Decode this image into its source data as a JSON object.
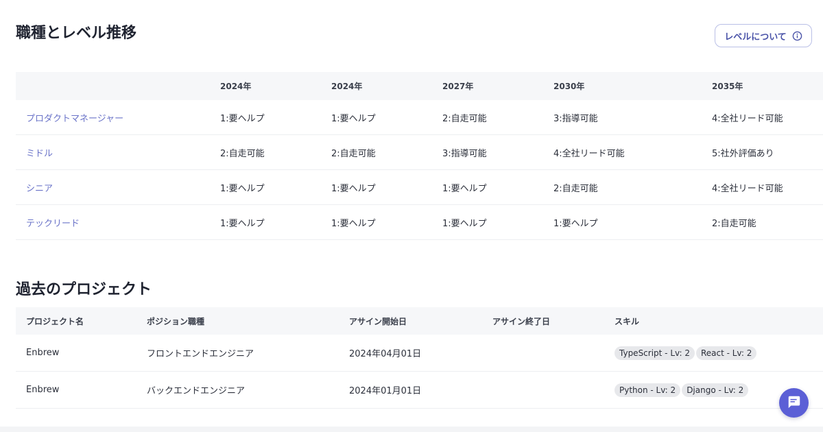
{
  "levels": {
    "title": "職種とレベル推移",
    "about_button": "レベルについて",
    "columns": [
      "",
      "2024年",
      "2024年",
      "2027年",
      "2030年",
      "2035年"
    ],
    "rows": [
      {
        "role": "プロダクトマネージャー",
        "values": [
          "1:要ヘルプ",
          "1:要ヘルプ",
          "2:自走可能",
          "3:指導可能",
          "4:全社リード可能"
        ]
      },
      {
        "role": "ミドル",
        "values": [
          "2:自走可能",
          "2:自走可能",
          "3:指導可能",
          "4:全社リード可能",
          "5:社外評価あり"
        ]
      },
      {
        "role": "シニア",
        "values": [
          "1:要ヘルプ",
          "1:要ヘルプ",
          "1:要ヘルプ",
          "2:自走可能",
          "4:全社リード可能"
        ]
      },
      {
        "role": "テックリード",
        "values": [
          "1:要ヘルプ",
          "1:要ヘルプ",
          "1:要ヘルプ",
          "1:要ヘルプ",
          "2:自走可能"
        ]
      }
    ]
  },
  "projects": {
    "title": "過去のプロジェクト",
    "columns": [
      "プロジェクト名",
      "ポジション職種",
      "アサイン開始日",
      "アサイン終了日",
      "スキル"
    ],
    "rows": [
      {
        "name": "Enbrew",
        "position": "フロントエンドエンジニア",
        "start": "2024年04月01日",
        "end": "",
        "skills": [
          "TypeScript - Lv: 2",
          "React - Lv: 2"
        ]
      },
      {
        "name": "Enbrew",
        "position": "バックエンドエンジニア",
        "start": "2024年01月01日",
        "end": "",
        "skills": [
          "Python - Lv: 2",
          "Django - Lv: 2"
        ]
      }
    ]
  },
  "icons": {
    "about": "info-icon",
    "chat": "chat-icon"
  },
  "colors": {
    "accent": "#5b5fd6",
    "link": "#6a73c8"
  }
}
